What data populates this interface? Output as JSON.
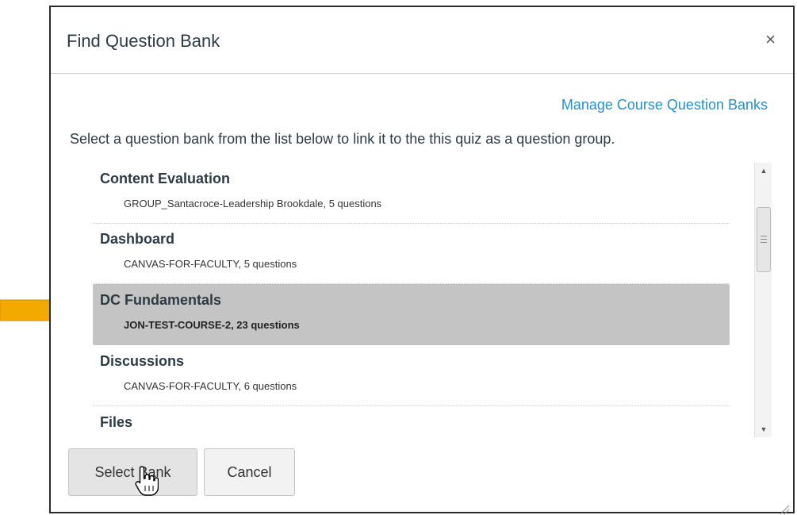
{
  "dialog": {
    "title": "Find Question Bank",
    "close_label": "×"
  },
  "manage_link": "Manage Course Question Banks",
  "instructions": "Select a question bank from the list below to link it to the this quiz as a question group.",
  "banks": [
    {
      "name": "Content Evaluation",
      "meta": "GROUP_Santacroce-Leadership Brookdale, 5 questions",
      "selected": false
    },
    {
      "name": "Dashboard",
      "meta": "CANVAS-FOR-FACULTY, 5 questions",
      "selected": false
    },
    {
      "name": "DC Fundamentals",
      "meta": "JON-TEST-COURSE-2, 23 questions",
      "selected": true
    },
    {
      "name": "Discussions",
      "meta": "CANVAS-FOR-FACULTY, 6 questions",
      "selected": false
    },
    {
      "name": "Files",
      "meta": "",
      "selected": false
    }
  ],
  "scrollbar": {
    "up_glyph": "▲",
    "down_glyph": "▼"
  },
  "buttons": {
    "select_bank": "Select Bank",
    "cancel": "Cancel"
  },
  "colors": {
    "accent_link": "#2a8ec4",
    "selected_row": "#c4c4c4",
    "pointer_arrow": "#f2a900"
  },
  "icons": {
    "close": "close-icon",
    "pointer": "arrow-right-icon",
    "cursor": "hand-pointer-icon",
    "resize": "resize-grip-icon"
  }
}
